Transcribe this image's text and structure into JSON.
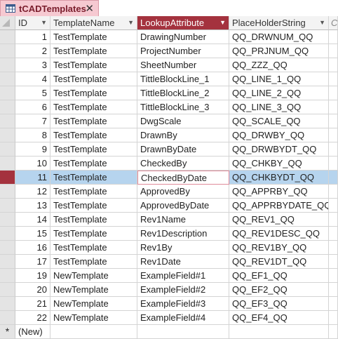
{
  "tab": {
    "title": "tCADTemplates",
    "close": "✕",
    "icon": "table-icon"
  },
  "headers": {
    "id": "ID",
    "template_name": "TemplateName",
    "lookup_attribute": "LookupAttribute",
    "placeholder_string": "PlaceHolderString",
    "clipped": "Clic"
  },
  "rows": [
    {
      "id": "1",
      "template": "TestTemplate",
      "lookup": "DrawingNumber",
      "placeholder": "QQ_DRWNUM_QQ"
    },
    {
      "id": "2",
      "template": "TestTemplate",
      "lookup": "ProjectNumber",
      "placeholder": "QQ_PRJNUM_QQ"
    },
    {
      "id": "3",
      "template": "TestTemplate",
      "lookup": "SheetNumber",
      "placeholder": "QQ_ZZZ_QQ"
    },
    {
      "id": "4",
      "template": "TestTemplate",
      "lookup": "TittleBlockLine_1",
      "placeholder": "QQ_LINE_1_QQ"
    },
    {
      "id": "5",
      "template": "TestTemplate",
      "lookup": "TittleBlockLine_2",
      "placeholder": "QQ_LINE_2_QQ"
    },
    {
      "id": "6",
      "template": "TestTemplate",
      "lookup": "TittleBlockLine_3",
      "placeholder": "QQ_LINE_3_QQ"
    },
    {
      "id": "7",
      "template": "TestTemplate",
      "lookup": "DwgScale",
      "placeholder": "QQ_SCALE_QQ"
    },
    {
      "id": "8",
      "template": "TestTemplate",
      "lookup": "DrawnBy",
      "placeholder": "QQ_DRWBY_QQ"
    },
    {
      "id": "9",
      "template": "TestTemplate",
      "lookup": "DrawnByDate",
      "placeholder": "QQ_DRWBYDT_QQ"
    },
    {
      "id": "10",
      "template": "TestTemplate",
      "lookup": "CheckedBy",
      "placeholder": "QQ_CHKBY_QQ"
    },
    {
      "id": "11",
      "template": "TestTemplate",
      "lookup": "CheckedByDate",
      "placeholder": "QQ_CHKBYDT_QQ"
    },
    {
      "id": "12",
      "template": "TestTemplate",
      "lookup": "ApprovedBy",
      "placeholder": "QQ_APPRBY_QQ"
    },
    {
      "id": "13",
      "template": "TestTemplate",
      "lookup": "ApprovedByDate",
      "placeholder": "QQ_APPRBYDATE_QQ"
    },
    {
      "id": "14",
      "template": "TestTemplate",
      "lookup": "Rev1Name",
      "placeholder": "QQ_REV1_QQ"
    },
    {
      "id": "15",
      "template": "TestTemplate",
      "lookup": "Rev1Description",
      "placeholder": "QQ_REV1DESC_QQ"
    },
    {
      "id": "16",
      "template": "TestTemplate",
      "lookup": "Rev1By",
      "placeholder": "QQ_REV1BY_QQ"
    },
    {
      "id": "17",
      "template": "TestTemplate",
      "lookup": "Rev1Date",
      "placeholder": "QQ_REV1DT_QQ"
    },
    {
      "id": "19",
      "template": "NewTemplate",
      "lookup": "ExampleField#1",
      "placeholder": "QQ_EF1_QQ"
    },
    {
      "id": "20",
      "template": "NewTemplate",
      "lookup": "ExampleField#2",
      "placeholder": "QQ_EF2_QQ"
    },
    {
      "id": "21",
      "template": "NewTemplate",
      "lookup": "ExampleField#3",
      "placeholder": "QQ_EF3_QQ"
    },
    {
      "id": "22",
      "template": "NewTemplate",
      "lookup": "ExampleField#4",
      "placeholder": "QQ_EF4_QQ"
    }
  ],
  "active_row_index": 10,
  "new_row": {
    "marker": "*",
    "label": "(New)"
  }
}
